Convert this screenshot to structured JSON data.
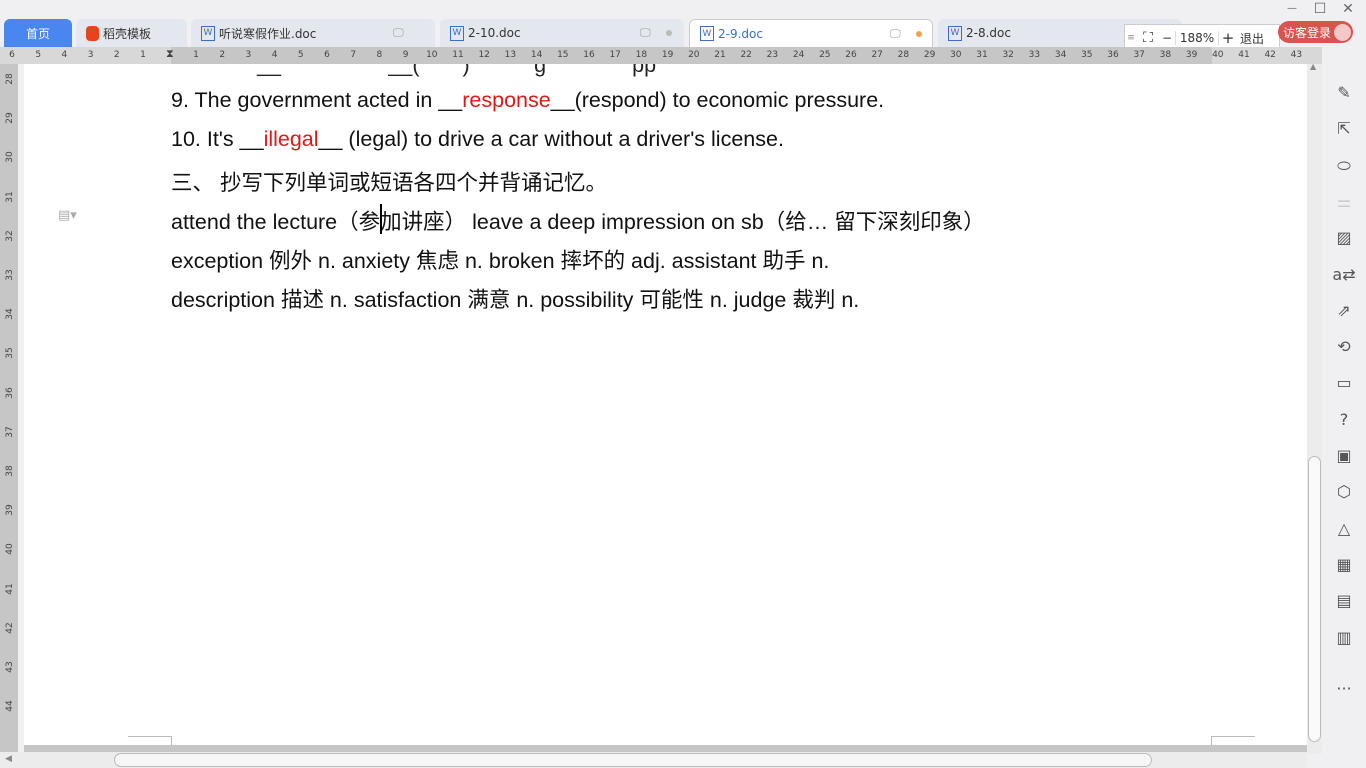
{
  "tabs": [
    {
      "label": "首页",
      "active": false,
      "home": true
    },
    {
      "label": "稻壳模板"
    },
    {
      "label": "听说寒假作业.doc"
    },
    {
      "label": "2-10.doc"
    },
    {
      "label": "2-9.doc",
      "active": true
    },
    {
      "label": "2-8.doc"
    }
  ],
  "zoom": {
    "value": "188%",
    "minus": "−",
    "plus": "+",
    "exit": "退出"
  },
  "login": "访客登录",
  "window": {
    "minimize": "—",
    "maximize": "☐",
    "close": "✕"
  },
  "ruler_left": [
    "6",
    "5",
    "4",
    "3",
    "2",
    "1"
  ],
  "ruler_right": [
    "1",
    "2",
    "3",
    "4",
    "5",
    "6",
    "7",
    "8",
    "9",
    "10",
    "11",
    "12",
    "13",
    "14",
    "15",
    "16",
    "17",
    "18",
    "19",
    "20",
    "21",
    "22",
    "23",
    "24",
    "25",
    "26",
    "27",
    "28",
    "29",
    "30",
    "31",
    "32",
    "33",
    "34",
    "35",
    "36",
    "37",
    "38",
    "39",
    "40",
    "41",
    "42",
    "43"
  ],
  "vruler": [
    "28",
    "29",
    "30",
    "31",
    "32",
    "33",
    "34",
    "35",
    "36",
    "37",
    "38",
    "39",
    "40",
    "41",
    "42",
    "43",
    "44"
  ],
  "doc": {
    "line9": {
      "pre": "9.  The government acted in __",
      "answer": "response",
      "post": "__(respond) to economic pressure."
    },
    "line10": {
      "pre": "10.  It's __",
      "answer": "illegal",
      "post": "__ (legal) to drive a car without a driver's license."
    },
    "section": "三、  抄写下列单词或短语各四个并背诵记忆。",
    "line_a": "attend  the  lecture（参加讲座）   leave  a  deep  impression  on  sb（给… 留下深刻印象）",
    "line_b": "exception 例外 n. anxiety 焦虑 n. broken 摔坏的 adj. assistant 助手 n.",
    "line_c": "description 描述 n. satisfaction 满意 n. possibility 可能性 n. judge 裁判 n."
  },
  "accent": "#4a86f0",
  "sidebar_icons": [
    "pen-icon",
    "cursor-icon",
    "shapes-icon",
    "sliders-icon",
    "image-frame-icon",
    "translate-icon",
    "share-icon",
    "history-icon",
    "archive-icon",
    "help-icon",
    "picture-icon",
    "badge-icon",
    "layers-icon",
    "table-icon",
    "apps-icon",
    "chart-icon",
    "more-icon"
  ]
}
